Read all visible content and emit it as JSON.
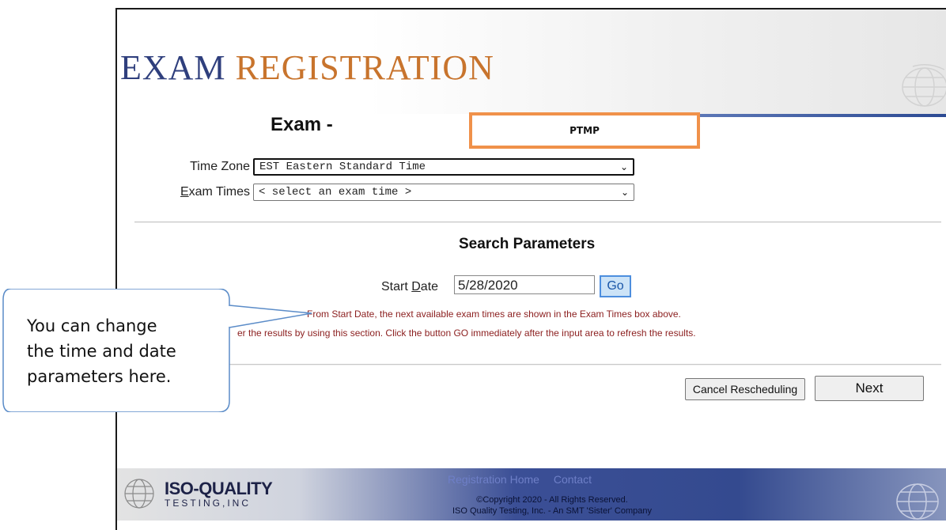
{
  "header": {
    "title_word1": "EXAM",
    "title_word2": "REGISTRATION",
    "exam_heading": "Exam -",
    "exam_highlight": "PTMP"
  },
  "form": {
    "time_zone_label": "Time Zone",
    "time_zone_value": "EST Eastern Standard Time",
    "exam_times_label_prefix": "E",
    "exam_times_label_rest": "xam Times",
    "exam_times_value": "< select an exam time >"
  },
  "search": {
    "title": "Search Parameters",
    "start_date_label_prefix": "Start ",
    "start_date_label_ul": "D",
    "start_date_label_rest": "ate",
    "start_date_value": "5/28/2020",
    "go_label": "Go",
    "help_line1": "From Start Date, the next available exam times are shown in the Exam Times box above.",
    "help_line2": "er the results by using this section. Click the button GO immediately after the input area to refresh the results."
  },
  "actions": {
    "cancel_label": "Cancel Rescheduling",
    "next_label": "Next"
  },
  "footer": {
    "logo_main": "ISO-QUALITY",
    "logo_sub": "TESTING,INC",
    "links": [
      "Registration Home",
      "Contact"
    ],
    "copyright_line1": "©Copyright 2020 - All Rights Reserved.",
    "copyright_line2": "ISO Quality Testing, Inc. - An SMT 'Sister' Company"
  },
  "callout": {
    "line1": "You can change",
    "line2": "the time and date",
    "line3": "parameters here."
  },
  "colors": {
    "title_blue": "#2f3f7d",
    "title_orange": "#c8742d",
    "highlight_border": "#f0914a",
    "help_text": "#8b1e1e",
    "callout_border": "#5b8cc8"
  }
}
